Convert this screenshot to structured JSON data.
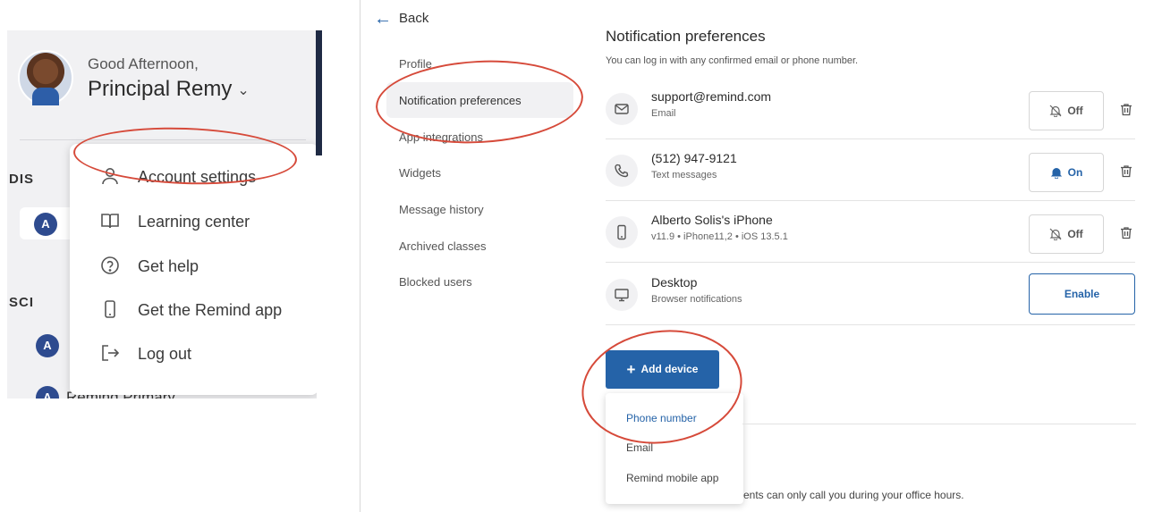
{
  "user_menu": {
    "greeting": "Good Afternoon,",
    "name": "Principal Remy",
    "sections": [
      "DIS",
      "SCI"
    ],
    "schools": [
      "",
      "",
      "Remind Primary"
    ],
    "items": [
      {
        "label": "Account settings",
        "icon": "person-icon"
      },
      {
        "label": "Learning center",
        "icon": "book-icon"
      },
      {
        "label": "Get help",
        "icon": "help-circle-icon"
      },
      {
        "label": "Get the Remind app",
        "icon": "phone-icon"
      },
      {
        "label": "Log out",
        "icon": "logout-icon"
      }
    ]
  },
  "settings": {
    "back_label": "Back",
    "nav": [
      "Profile",
      "Notification preferences",
      "App integrations",
      "Widgets",
      "Message history",
      "Archived classes",
      "Blocked users"
    ],
    "title": "Notification preferences",
    "subtitle": "You can log in with any confirmed email or phone number.",
    "devices": [
      {
        "title": "support@remind.com",
        "sub": "Email",
        "state": "Off",
        "icon": "mail-icon"
      },
      {
        "title": "(512) 947-9121",
        "sub": "Text messages",
        "state": "On",
        "icon": "phone-call-icon"
      },
      {
        "title": "Alberto Solis's iPhone",
        "sub": "v11.9 • iPhone11,2 • iOS 13.5.1",
        "state": "Off",
        "icon": "mobile-icon"
      },
      {
        "title": "Desktop",
        "sub": "Browser notifications",
        "action": "Enable",
        "icon": "monitor-icon"
      }
    ],
    "add_device_label": "Add device",
    "add_options": [
      "Phone number",
      "Email",
      "Remind mobile app"
    ],
    "office_hours_text": "ents can only call you during your office hours."
  },
  "colors": {
    "accent": "#2563a8",
    "annotation": "#d64a3a",
    "panel_bg": "#f1f1f3"
  }
}
